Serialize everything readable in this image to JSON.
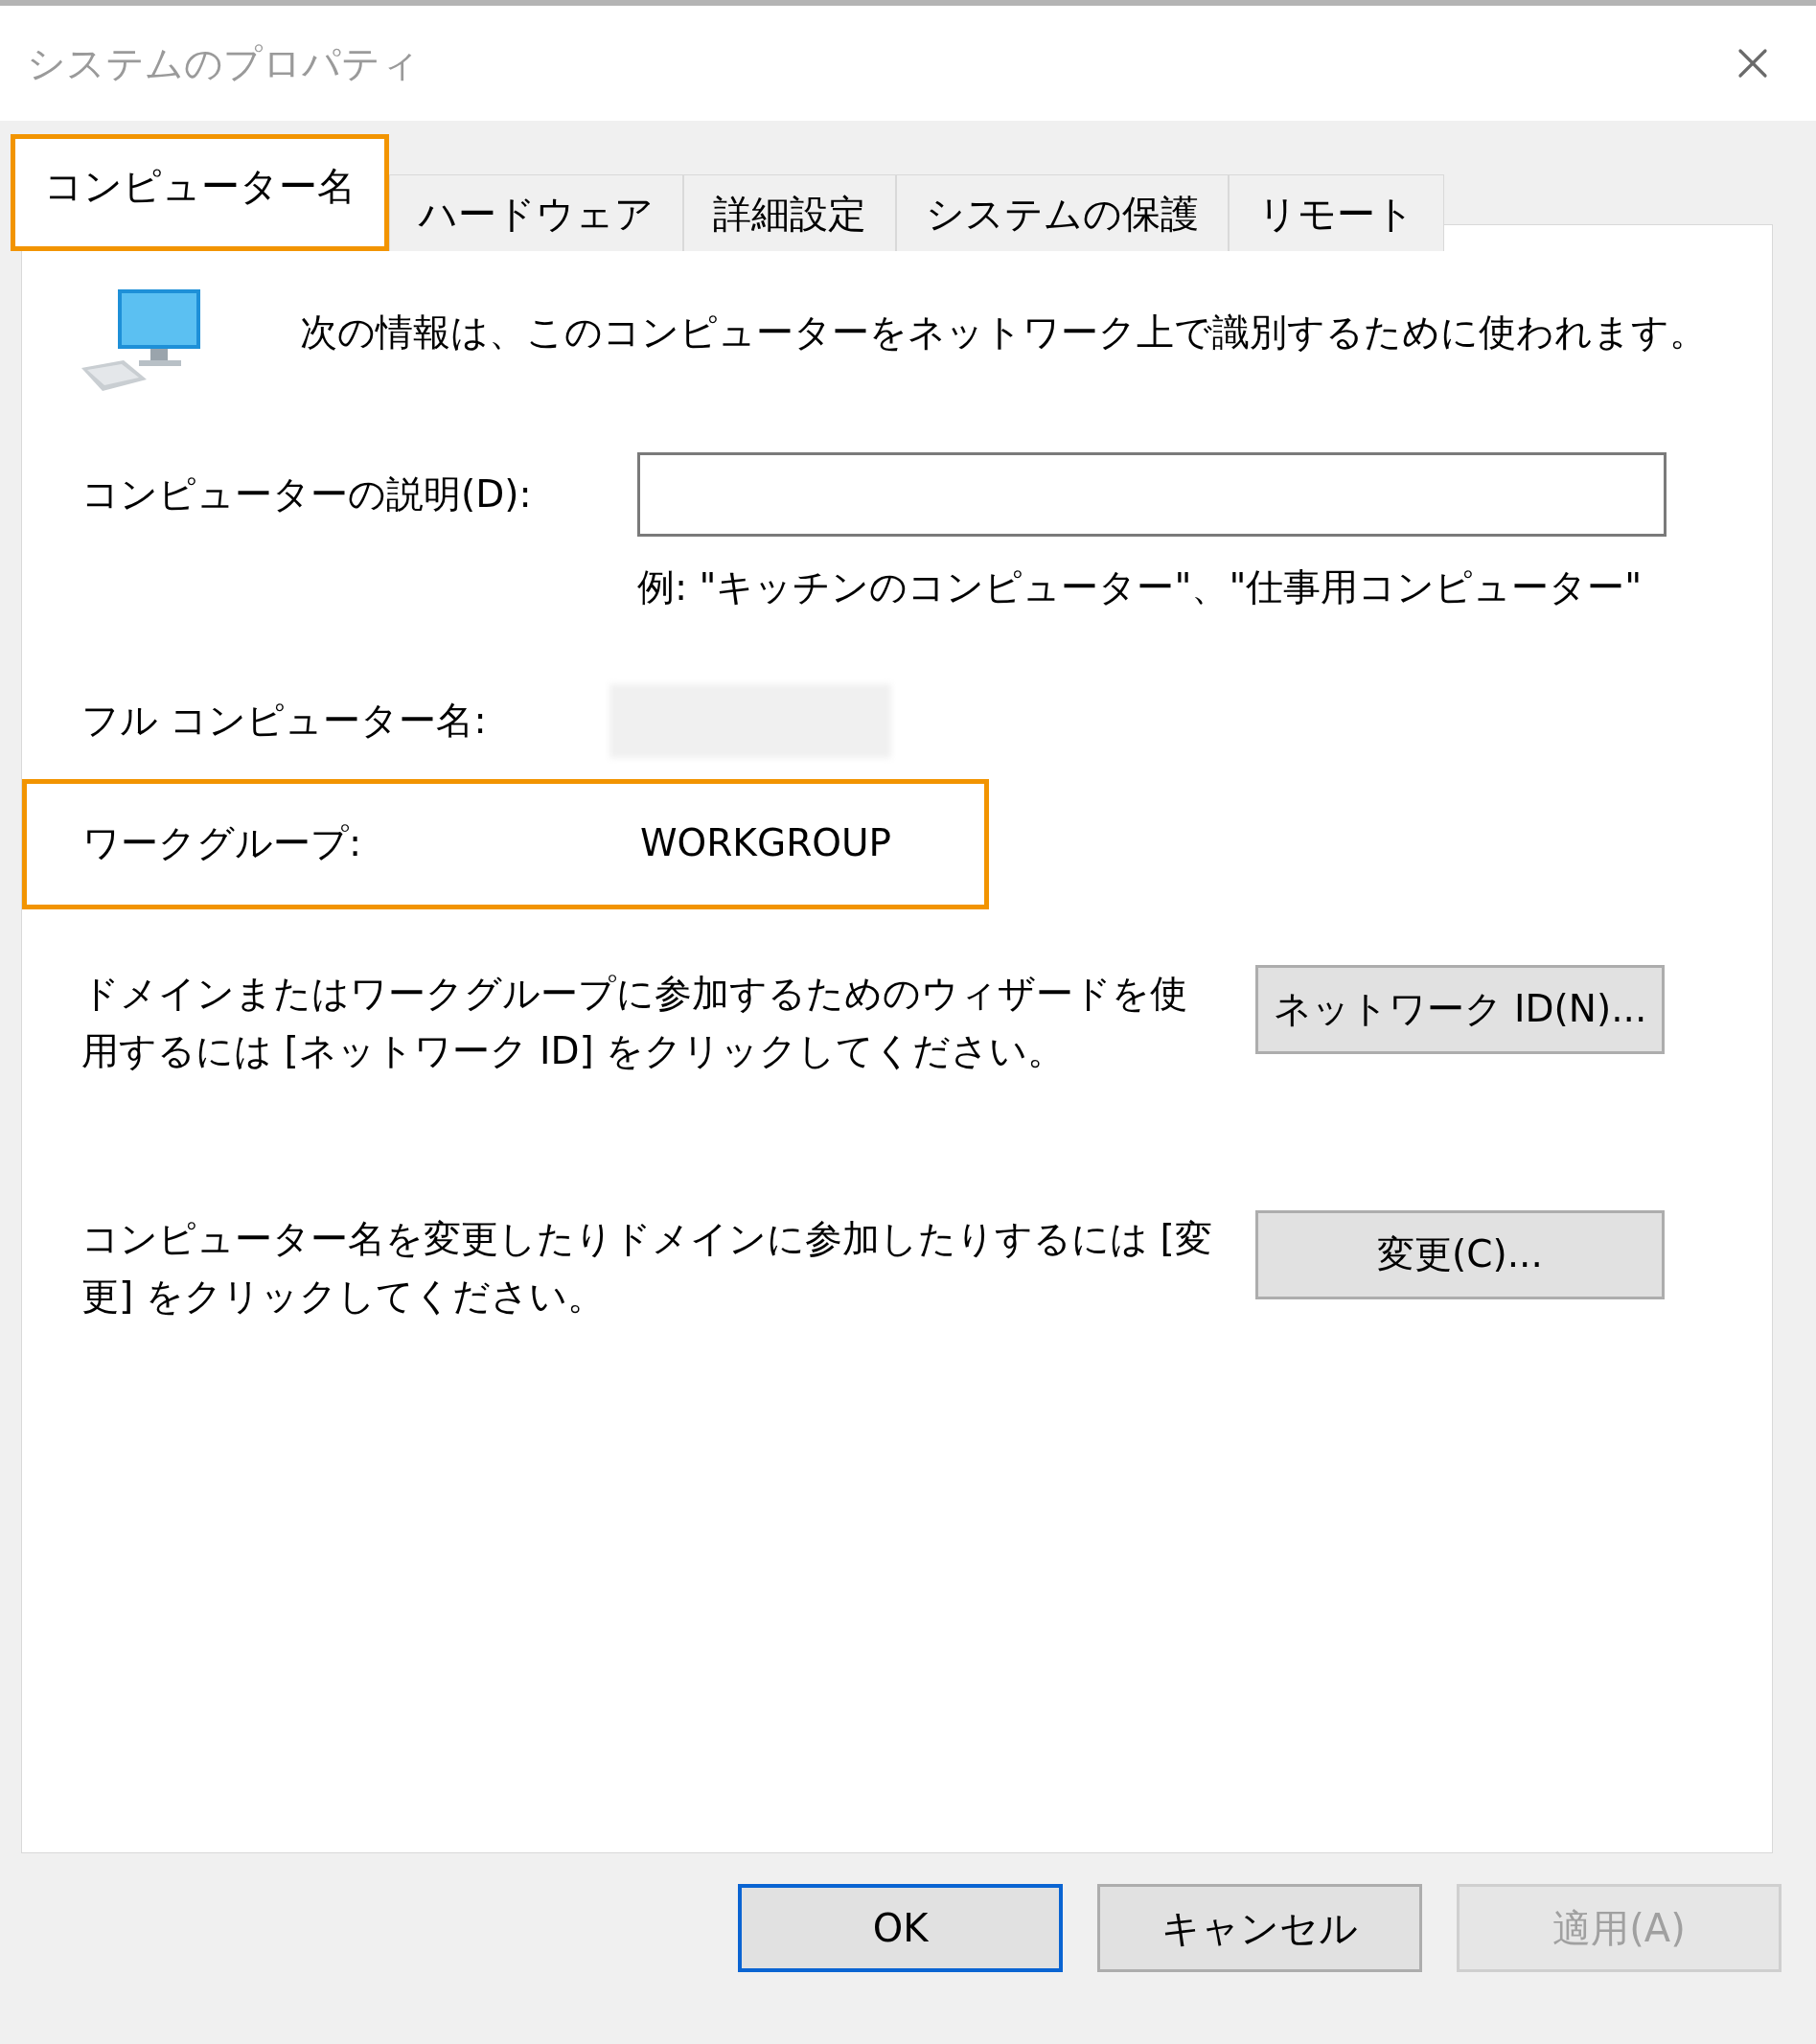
{
  "window": {
    "title": "システムのプロパティ"
  },
  "tabs": [
    {
      "label": "コンピューター名",
      "selected": true,
      "highlighted": true
    },
    {
      "label": "ハードウェア",
      "selected": false,
      "highlighted": false
    },
    {
      "label": "詳細設定",
      "selected": false,
      "highlighted": false
    },
    {
      "label": "システムの保護",
      "selected": false,
      "highlighted": false
    },
    {
      "label": "リモート",
      "selected": false,
      "highlighted": false
    }
  ],
  "intro": "次の情報は、このコンピューターをネットワーク上で識別するために使われます。",
  "description": {
    "label": "コンピューターの説明(D):",
    "example": "例: \"キッチンのコンピューター\"、\"仕事用コンピューター\""
  },
  "full_name": {
    "label": "フル コンピューター名:",
    "blurred": true
  },
  "workgroup": {
    "label": "ワークグループ:",
    "value": "WORKGROUP",
    "highlighted": true
  },
  "actions": [
    {
      "text": "ドメインまたはワークグループに参加するためのウィザードを使用するには [ネットワーク ID] をクリックしてください。",
      "button": "ネットワーク ID(N)..."
    },
    {
      "text": "コンピューター名を変更したりドメインに参加したりするには [変更] をクリックしてください。",
      "button": "変更(C)..."
    }
  ],
  "buttons": [
    {
      "label": "OK",
      "default": true,
      "disabled": false
    },
    {
      "label": "キャンセル",
      "default": false,
      "disabled": false
    },
    {
      "label": "適用(A)",
      "default": false,
      "disabled": true
    }
  ]
}
